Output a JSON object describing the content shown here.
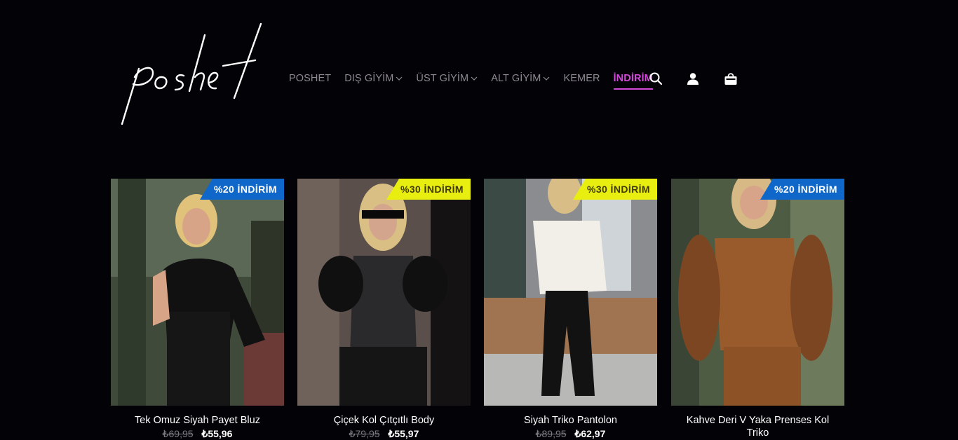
{
  "brand": {
    "logo_text": "poshet"
  },
  "nav": {
    "items": [
      {
        "label": "POSHET",
        "dropdown": false
      },
      {
        "label": "DIŞ GİYİM",
        "dropdown": true
      },
      {
        "label": "ÜST GİYİM",
        "dropdown": true
      },
      {
        "label": "ALT GİYİM",
        "dropdown": true
      },
      {
        "label": "KEMER",
        "dropdown": false
      },
      {
        "label": "İNDİRİM",
        "dropdown": false,
        "active": true
      }
    ],
    "icons": [
      "search-icon",
      "account-icon",
      "cart-icon"
    ]
  },
  "colors": {
    "background": "#030207",
    "accent": "#d248d8",
    "badge_blue": "#0f68c9",
    "badge_yellow": "#e8ef10"
  },
  "products": [
    {
      "title": "Tek Omuz Siyah Payet Bluz",
      "badge": "%20 İNDİRİM",
      "badge_color": "blue",
      "old_price": "₺69,95",
      "new_price": "₺55,96"
    },
    {
      "title": "Çiçek Kol Çıtçıtlı Body",
      "badge": "%30 İNDİRİM",
      "badge_color": "yellow",
      "old_price": "₺79,95",
      "new_price": "₺55,97"
    },
    {
      "title": "Siyah Triko Pantolon",
      "badge": "%30 İNDİRİM",
      "badge_color": "yellow",
      "old_price": "₺89,95",
      "new_price": "₺62,97"
    },
    {
      "title": "Kahve Deri V Yaka Prenses Kol Triko",
      "badge": "%20 İNDİRİM",
      "badge_color": "blue",
      "old_price": "",
      "new_price": ""
    }
  ]
}
